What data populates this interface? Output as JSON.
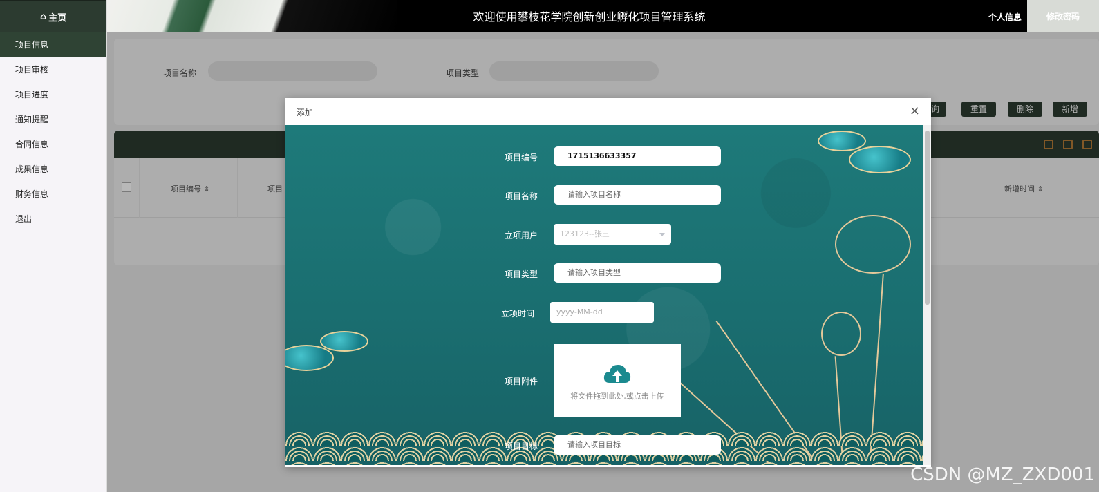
{
  "sidebar": {
    "home_label": "主页",
    "items": [
      {
        "label": "项目信息"
      },
      {
        "label": "项目审核"
      },
      {
        "label": "项目进度"
      },
      {
        "label": "通知提醒"
      },
      {
        "label": "合同信息"
      },
      {
        "label": "成果信息"
      },
      {
        "label": "财务信息"
      },
      {
        "label": "退出"
      }
    ]
  },
  "header": {
    "title": "欢迎使用攀枝花学院创新创业孵化项目管理系统",
    "profile_label": "个人信息",
    "change_password_label": "修改密码"
  },
  "search": {
    "name_label": "项目名称",
    "type_label": "项目类型"
  },
  "actions": {
    "query_partial": "询",
    "reset": "重置",
    "delete": "删除",
    "add": "新增"
  },
  "table": {
    "columns": [
      "项目编号",
      "项目",
      "新增时间"
    ]
  },
  "modal": {
    "title": "添加",
    "close": "×",
    "fields": {
      "code_label": "项目编号",
      "code_value": "1715136633357",
      "name_label": "项目名称",
      "name_placeholder": "请输入项目名称",
      "user_label": "立项用户",
      "user_value": "123123--张三",
      "type_label": "项目类型",
      "type_placeholder": "请输入项目类型",
      "date_label": "立项时间",
      "date_placeholder": "yyyy-MM-dd",
      "attachment_label": "项目附件",
      "upload_text": "将文件拖到此处,或点击上传",
      "goal_label": "项目目标",
      "goal_placeholder": "请输入项目目标"
    }
  },
  "watermark": "CSDN @MZ_ZXD001",
  "colors": {
    "dark_green": "#2c3b30",
    "teal_bg": "#1a6e70",
    "gold": "#e3c89a",
    "icon_teal": "#1b8a8f"
  }
}
